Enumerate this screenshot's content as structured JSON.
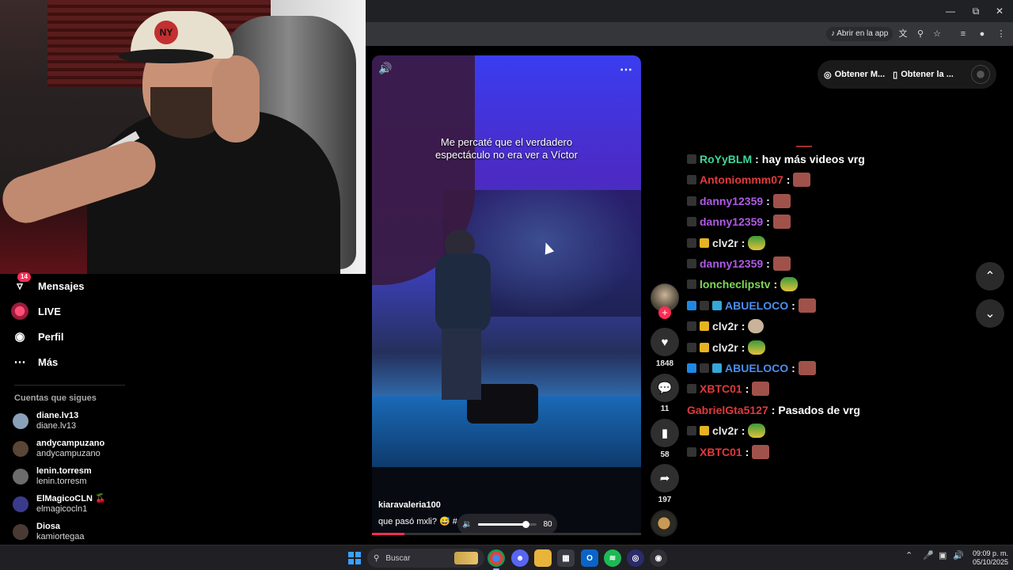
{
  "window": {
    "minimize_icon": "minimize-icon",
    "maximize_icon": "restore-icon",
    "close_icon": "close-icon"
  },
  "toolbar": {
    "open_in_app_label": "Abrir en la app"
  },
  "sidebar": {
    "nav": [
      {
        "label": "Mensajes",
        "icon": "inbox-icon",
        "badge": "14"
      },
      {
        "label": "LIVE",
        "icon": "live-icon"
      },
      {
        "label": "Perfil",
        "icon": "profile-icon"
      },
      {
        "label": "Más",
        "icon": "more-icon"
      }
    ],
    "following_title": "Cuentas que sigues",
    "following": [
      {
        "name": "diane.lv13",
        "handle": "diane.lv13"
      },
      {
        "name": "andycampuzano",
        "handle": "andycampuzano"
      },
      {
        "name": "lenin.torresm",
        "handle": "lenin.torresm"
      },
      {
        "name": "ElMagicoCLN 🍒",
        "handle": "elmagicocln1"
      },
      {
        "name": "Diosa",
        "handle": "kamiortegaa"
      }
    ]
  },
  "video": {
    "caption_line1": "Me percaté que el verdadero",
    "caption_line2": "espectáculo no era ver a Víctor",
    "author": "kiaravaleria100",
    "description": "que pasó mxli? 😅 #",
    "volume": "80",
    "volume_fraction": 0.8,
    "progress_fraction": 0.12
  },
  "actions": {
    "likes": "1848",
    "comments": "11",
    "saves": "58",
    "shares": "197"
  },
  "top_buttons": {
    "get_coins": "Obtener M...",
    "get_app": "Obtener la ..."
  },
  "chat": [
    {
      "user": "RoYyBLM",
      "color": "#3fd69a",
      "badges": [
        "mod"
      ],
      "message": "hay más videos vrg",
      "emote": ""
    },
    {
      "user": "Antoniommm07",
      "color": "#e03a3a",
      "badges": [
        "mod"
      ],
      "message": "",
      "emote": "face"
    },
    {
      "user": "danny12359",
      "color": "#b05ae6",
      "badges": [
        "mod"
      ],
      "message": "",
      "emote": "face"
    },
    {
      "user": "danny12359",
      "color": "#b05ae6",
      "badges": [
        "mod"
      ],
      "message": "",
      "emote": "face"
    },
    {
      "user": "clv2r",
      "color": "#e6e6e6",
      "badges": [
        "mod",
        "crown"
      ],
      "message": "",
      "emote": "frog"
    },
    {
      "user": "danny12359",
      "color": "#b05ae6",
      "badges": [
        "mod"
      ],
      "message": "",
      "emote": "face"
    },
    {
      "user": "loncheclipstv",
      "color": "#7ed957",
      "badges": [
        "mod"
      ],
      "message": "",
      "emote": "frog"
    },
    {
      "user": "ABUELOCO",
      "color": "#4c8df0",
      "badges": [
        "arrow",
        "mod",
        "qr"
      ],
      "message": "",
      "emote": "face"
    },
    {
      "user": "clv2r",
      "color": "#e6e6e6",
      "badges": [
        "mod",
        "crown"
      ],
      "message": "",
      "emote": "cat"
    },
    {
      "user": "clv2r",
      "color": "#e6e6e6",
      "badges": [
        "mod",
        "crown"
      ],
      "message": "",
      "emote": "frog"
    },
    {
      "user": "ABUELOCO",
      "color": "#4c8df0",
      "badges": [
        "arrow",
        "mod",
        "qr"
      ],
      "message": "",
      "emote": "face"
    },
    {
      "user": "XBTC01",
      "color": "#e03a3a",
      "badges": [
        "mod"
      ],
      "message": "",
      "emote": "face"
    },
    {
      "user": "GabrielGta5127",
      "color": "#e03a3a",
      "badges": [],
      "message": "Pasados de vrg",
      "emote": ""
    },
    {
      "user": "clv2r",
      "color": "#e6e6e6",
      "badges": [
        "mod",
        "crown"
      ],
      "message": "",
      "emote": "frog"
    },
    {
      "user": "XBTC01",
      "color": "#e03a3a",
      "badges": [
        "mod"
      ],
      "message": "",
      "emote": "face"
    }
  ],
  "taskbar": {
    "search_placeholder": "Buscar",
    "time": "09:09 p. m.",
    "date": "05/10/2025",
    "apps": [
      "chrome-icon",
      "discord-icon",
      "file-explorer-icon",
      "store-icon",
      "outlook-icon",
      "spotify-icon",
      "app-icon",
      "obs-icon"
    ]
  }
}
